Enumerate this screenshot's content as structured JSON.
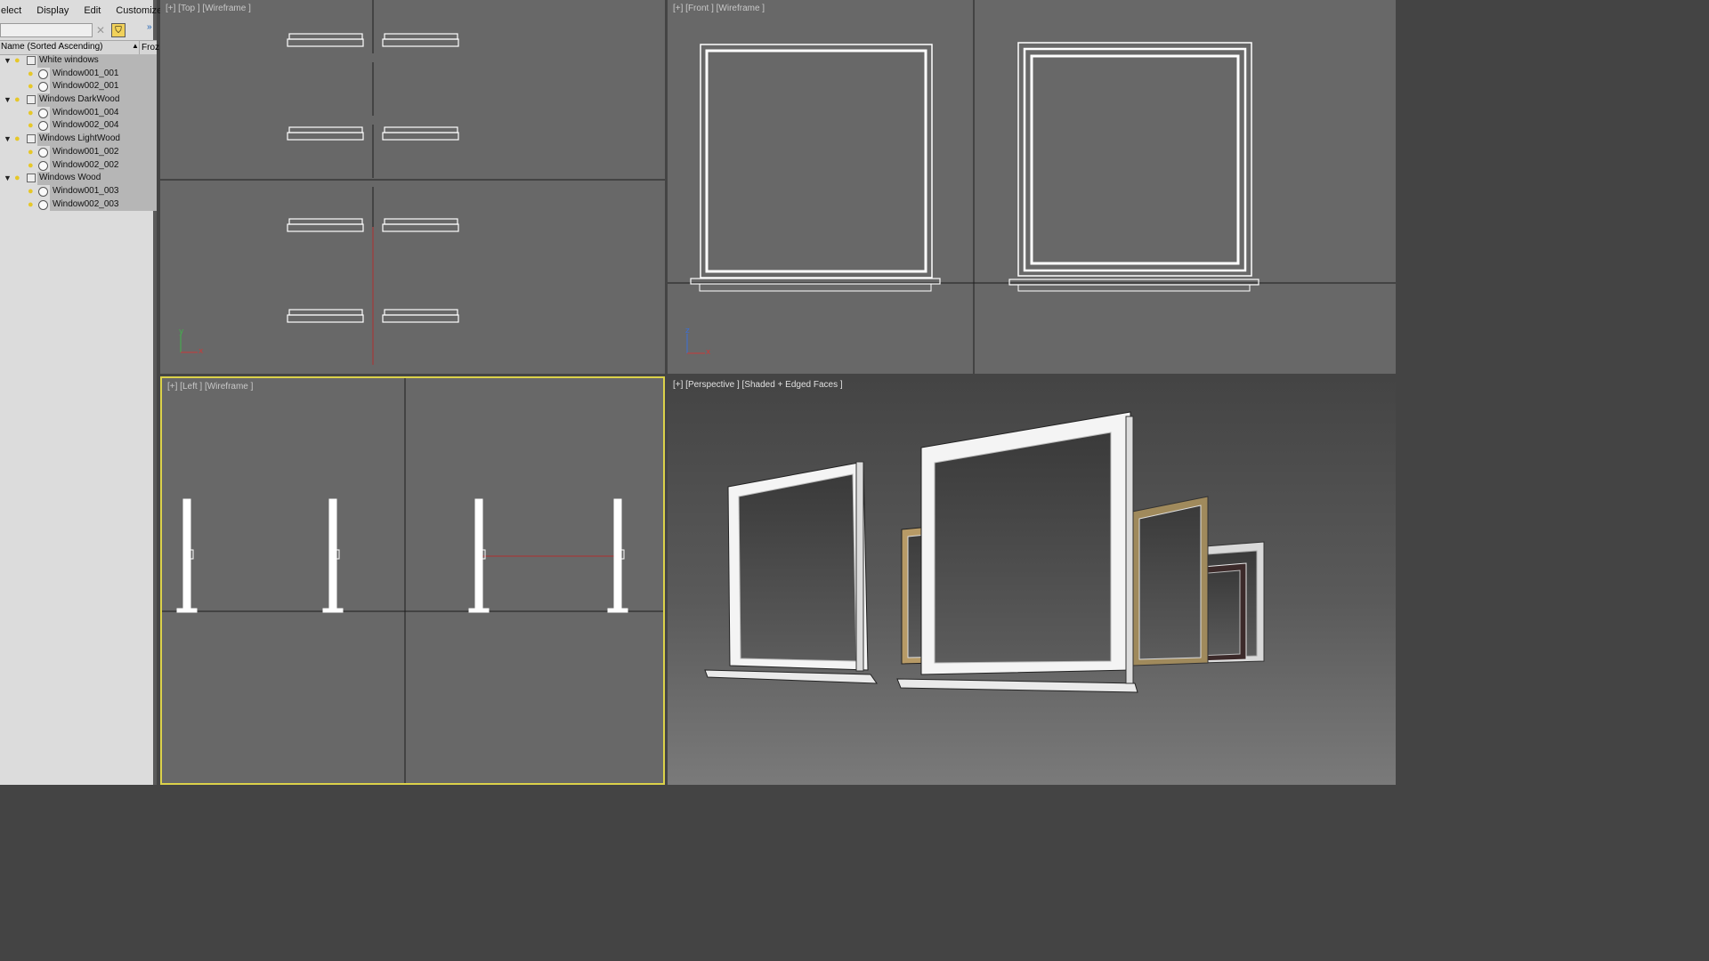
{
  "menu": [
    "elect",
    "Display",
    "Edit",
    "Customize"
  ],
  "explorer": {
    "column_name": "Name (Sorted Ascending)",
    "column_frozen": "Froz",
    "layers": [
      {
        "name": "White windows",
        "objects": [
          "Window001_001",
          "Window002_001"
        ]
      },
      {
        "name": "Windows DarkWood",
        "objects": [
          "Window001_004",
          "Window002_004"
        ]
      },
      {
        "name": "Windows LightWood",
        "objects": [
          "Window001_002",
          "Window002_002"
        ]
      },
      {
        "name": "Windows Wood",
        "objects": [
          "Window001_003",
          "Window002_003"
        ]
      }
    ]
  },
  "viewports": {
    "top": {
      "label": "[+] [Top ] [Wireframe ]"
    },
    "front": {
      "label": "[+] [Front ] [Wireframe ]"
    },
    "left": {
      "label": "[+] [Left ] [Wireframe ]",
      "active": true
    },
    "perspective": {
      "label": "[+] [Perspective ] [Shaded + Edged Faces ]"
    }
  },
  "axis_labels": {
    "x": "x",
    "y": "y",
    "z": "z"
  },
  "colors": {
    "active_border": "#dcd24a",
    "bulb": "#e6c728",
    "grid_bg": "#686868"
  }
}
